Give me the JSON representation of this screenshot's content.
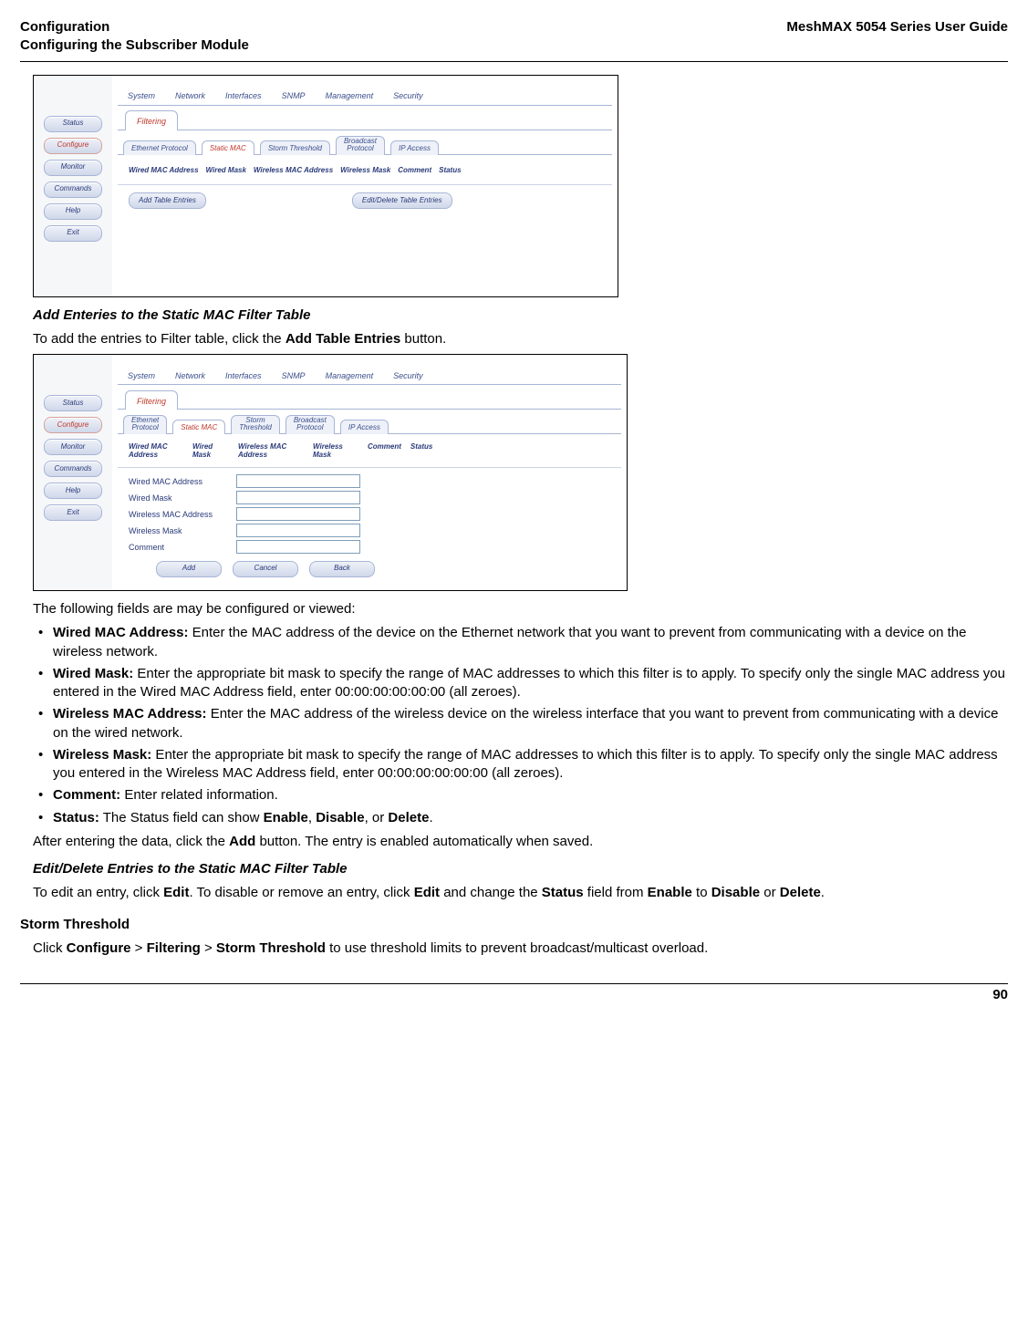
{
  "header": {
    "left_line1": "Configuration",
    "left_line2": "Configuring the Subscriber Module",
    "right": "MeshMAX 5054 Series User Guide"
  },
  "shot1": {
    "sidebar": [
      "Status",
      "Configure",
      "Monitor",
      "Commands",
      "Help",
      "Exit"
    ],
    "sidebar_active_index": 1,
    "top_tabs": [
      "System",
      "Network",
      "Interfaces",
      "SNMP",
      "Management",
      "Security"
    ],
    "second_tab": "Filtering",
    "sub_tabs": [
      "Ethernet Protocol",
      "Static MAC",
      "Storm Threshold",
      "Broadcast Protocol",
      "IP Access"
    ],
    "sub_tab_active_index": 1,
    "table_headers": [
      "Wired MAC Address",
      "Wired Mask",
      "Wireless MAC Address",
      "Wireless Mask",
      "Comment",
      "Status"
    ],
    "buttons": {
      "add": "Add Table Entries",
      "edit": "Edit/Delete Table Entries"
    }
  },
  "shot2": {
    "sidebar": [
      "Status",
      "Configure",
      "Monitor",
      "Commands",
      "Help",
      "Exit"
    ],
    "sidebar_active_index": 1,
    "top_tabs": [
      "System",
      "Network",
      "Interfaces",
      "SNMP",
      "Management",
      "Security"
    ],
    "second_tab": "Filtering",
    "sub_tabs": [
      "Ethernet Protocol",
      "Static MAC",
      "Storm Threshold",
      "Broadcast Protocol",
      "IP Access"
    ],
    "sub_tab_active_index": 1,
    "table_headers": [
      "Wired MAC Address",
      "Wired Mask",
      "Wireless MAC Address",
      "Wireless Mask",
      "Comment",
      "Status"
    ],
    "form_labels": [
      "Wired MAC Address",
      "Wired Mask",
      "Wireless MAC Address",
      "Wireless Mask",
      "Comment"
    ],
    "buttons": {
      "add": "Add",
      "cancel": "Cancel",
      "back": "Back"
    }
  },
  "doc": {
    "h1": "Add Enteries to the Static MAC Filter Table",
    "p1a": "To add the entries to Filter table, click the ",
    "p1b": "Add Table Entries",
    "p1c": " button.",
    "p2": "The following fields are may be configured or viewed:",
    "bullets": [
      {
        "label": "Wired MAC Address:",
        "text": " Enter the MAC address of the device on the Ethernet network that you want to prevent from communicating with a device on the wireless network."
      },
      {
        "label": "Wired Mask:",
        "text": " Enter the appropriate bit mask to specify the range of MAC addresses to which this filter is to apply. To specify only the single MAC address you entered in the Wired MAC Address field, enter 00:00:00:00:00:00 (all zeroes)."
      },
      {
        "label": "Wireless MAC Address:",
        "text": " Enter the MAC address of the wireless device on the wireless interface that you want to prevent from communicating with a device on the wired network."
      },
      {
        "label": "Wireless Mask:",
        "text": " Enter the appropriate bit mask to specify the range of MAC addresses to which this filter is to apply. To specify only the single MAC address you entered in the Wireless MAC Address field, enter 00:00:00:00:00:00 (all zeroes)."
      },
      {
        "label": "Comment:",
        "text": " Enter related information."
      },
      {
        "label": "Status:",
        "text": " The Status field can show ",
        "b1": "Enable",
        "mid1": ", ",
        "b2": "Disable",
        "mid2": ", or ",
        "b3": "Delete",
        "end": "."
      }
    ],
    "p3a": "After entering the data, click the ",
    "p3b": "Add",
    "p3c": " button. The entry is enabled automatically when saved.",
    "h2": "Edit/Delete Entries to the Static MAC Filter Table",
    "p4a": "To edit an entry, click ",
    "p4b": "Edit",
    "p4c": ". To disable or remove an entry, click ",
    "p4d": "Edit",
    "p4e": " and change the ",
    "p4f": "Status",
    "p4g": " field from ",
    "p4h": "Enable",
    "p4i": " to ",
    "p4j": "Disable",
    "p4k": " or ",
    "p4l": "Delete",
    "p4m": ".",
    "storm_head": "Storm Threshold",
    "p5a": "Click ",
    "p5b": "Configure",
    "p5c": " > ",
    "p5d": "Filtering",
    "p5e": " > ",
    "p5f": "Storm Threshold",
    "p5g": " to use threshold limits to prevent broadcast/multicast overload."
  },
  "footer": {
    "page": "90"
  }
}
